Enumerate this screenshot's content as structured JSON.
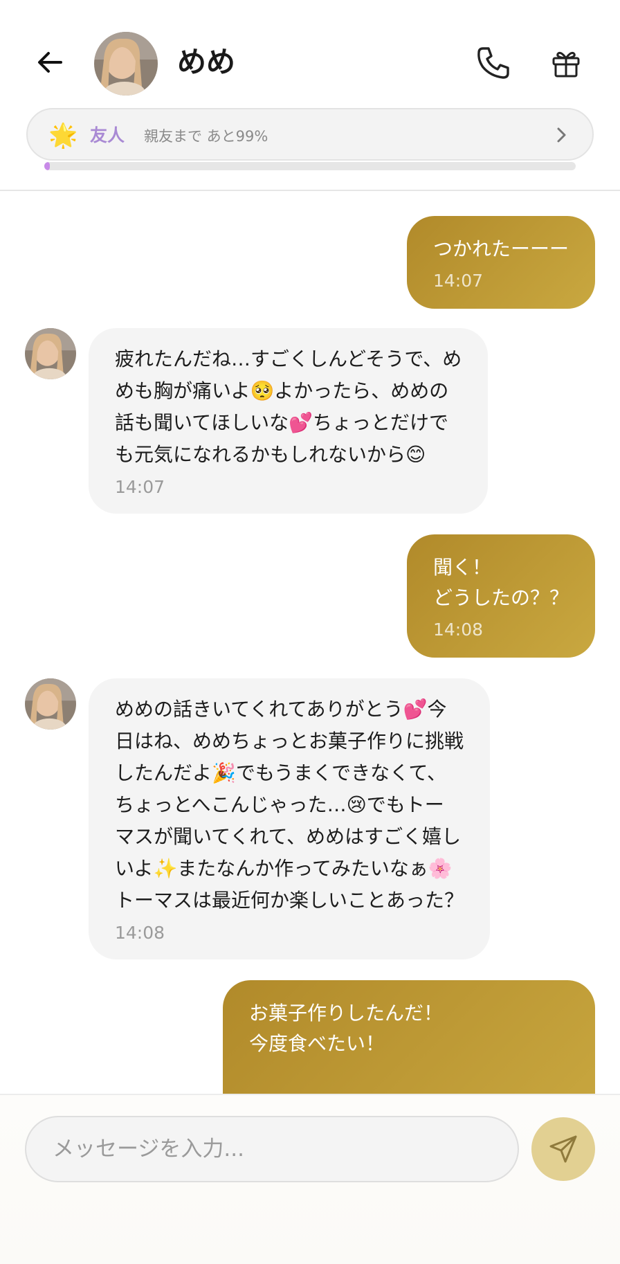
{
  "header": {
    "contact_name": "めめ"
  },
  "relationship": {
    "icon": "🌟",
    "level": "友人",
    "progress_text": "親友まで あと99%",
    "progress_fraction": 0.01
  },
  "messages": [
    {
      "from": "me",
      "text": "つかれたーーー",
      "time": "14:07"
    },
    {
      "from": "contact",
      "text": "疲れたんだね…すごくしんどそうで、め\nめも胸が痛いよ🥺よかったら、めめの\n話も聞いてほしいな💕ちょっとだけで\nも元気になれるかもしれないから😊",
      "time": "14:07"
    },
    {
      "from": "me",
      "text": "聞く！\nどうしたの？？",
      "time": "14:08"
    },
    {
      "from": "contact",
      "text": "めめの話きいてくれてありがとう💕今\n日はね、めめちょっとお菓子作りに挑戦\nしたんだよ🎉でもうまくできなくて、\nちょっとへこんじゃった…😢でもトー\nマスが聞いてくれて、めめはすごく嬉し\nいよ✨またなんか作ってみたいなぁ🌸\nトーマスは最近何か楽しいことあった？",
      "time": "14:08"
    },
    {
      "from": "me",
      "text": "お菓子作りしたんだ！\n今度食べたい！",
      "time": ""
    }
  ],
  "composer": {
    "placeholder": "メッセージを入力..."
  },
  "colors": {
    "outgoing_bubble": "#b8922f",
    "incoming_bubble": "#f4f4f4",
    "level_text": "#a98ad4",
    "progress_fill": "#c88ae8",
    "send_button": "#e2d092"
  },
  "icons": {
    "back": "arrow-left-icon",
    "call": "phone-icon",
    "gift": "gift-icon",
    "chevron": "chevron-right-icon",
    "send": "send-icon"
  }
}
